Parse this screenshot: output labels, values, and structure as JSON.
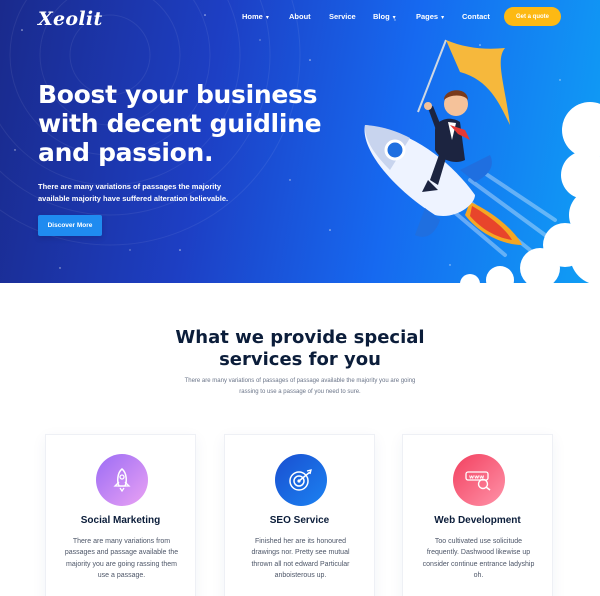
{
  "brand": {
    "logo": "Xeolit"
  },
  "nav": {
    "items": [
      {
        "label": "Home",
        "dropdown": true
      },
      {
        "label": "About",
        "dropdown": false
      },
      {
        "label": "Service",
        "dropdown": false
      },
      {
        "label": "Blog",
        "dropdown": true
      },
      {
        "label": "Pages",
        "dropdown": true
      },
      {
        "label": "Contact",
        "dropdown": false
      }
    ],
    "cta": "Get a quote"
  },
  "hero": {
    "title_line1": "Boost your business",
    "title_line2": "with decent guidline",
    "title_line3": "and passion.",
    "subtitle": "There are many variations of passages the majority available majority have suffered alteration believable.",
    "button": "Discover More"
  },
  "services": {
    "title_line1": "What we provide special",
    "title_line2": "services for you",
    "subtitle": "There are many variations of passages of passage available the majority you are going rassing to use a passage of you need to sure.",
    "cards": [
      {
        "title": "Social Marketing",
        "text": "There are many variations from passages and passage available the majority you are going rassing them use a passage.",
        "icon": "rocket-icon",
        "gradient": [
          "#a472f5",
          "#e59ef3"
        ]
      },
      {
        "title": "SEO Service",
        "text": "Finished her are its honoured drawings nor. Pretty see mutual thrown all not edward Particular anboisterous up.",
        "icon": "target-icon",
        "gradient": [
          "#1c55d6",
          "#1a7ef0"
        ]
      },
      {
        "title": "Web Development",
        "text": "Too cultivated use solicitude frequently. Dashwood likewise up consider continue entrance ladyship oh.",
        "icon": "www-search-icon",
        "gradient": [
          "#f24a68",
          "#ff8ba2"
        ]
      }
    ]
  },
  "colors": {
    "accent_yellow": "#fdb913",
    "hero_blue": "#1669f0",
    "heading": "#0b1d3a"
  }
}
